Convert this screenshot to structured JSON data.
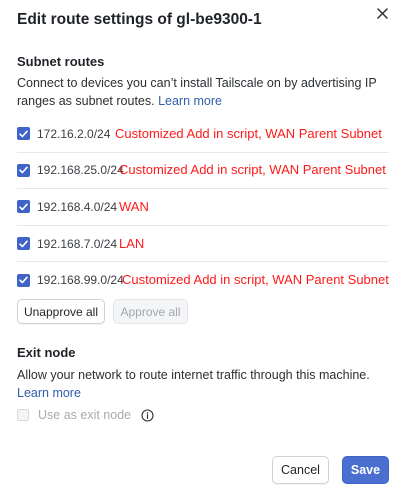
{
  "dialog": {
    "title": "Edit route settings of gl-be9300-1",
    "close_icon": "close-icon"
  },
  "subnet": {
    "heading": "Subnet routes",
    "description": "Connect to devices you can’t install Tailscale on by advertising IP ranges as subnet routes.",
    "learn_more": "Learn more",
    "routes": [
      {
        "ip": "172.16.2.0/24",
        "checked": true,
        "note": "Customized Add in script, WAN Parent Subnet"
      },
      {
        "ip": "192.168.25.0/24",
        "checked": true,
        "note": "Customized Add in script, WAN Parent Subnet"
      },
      {
        "ip": "192.168.4.0/24",
        "checked": true,
        "note": "WAN"
      },
      {
        "ip": "192.168.7.0/24",
        "checked": true,
        "note": "LAN"
      },
      {
        "ip": "192.168.99.0/24",
        "checked": true,
        "note": "Customized Add in script, WAN Parent Subnet"
      }
    ],
    "unapprove_all": "Unapprove all",
    "approve_all": "Approve all"
  },
  "exit_node": {
    "heading": "Exit node",
    "description": "Allow your network to route internet traffic through this machine.",
    "learn_more": "Learn more",
    "checkbox_label": "Use as exit node",
    "checked": false,
    "disabled": true,
    "info_icon": "info-icon"
  },
  "footer": {
    "cancel": "Cancel",
    "save": "Save"
  },
  "colors": {
    "accent": "#4a6fd0",
    "checkbox": "#3f63c7",
    "link": "#2f5ea8",
    "annotation": "#ff1a1a"
  }
}
